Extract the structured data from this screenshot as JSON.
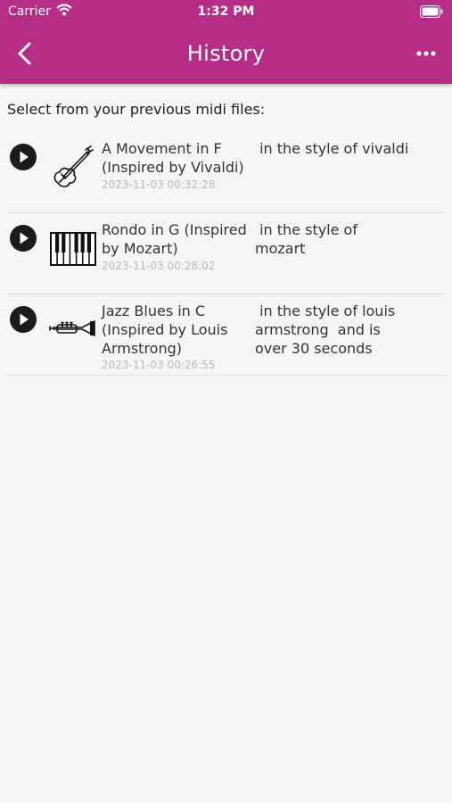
{
  "status_bar": {
    "carrier": "Carrier",
    "time": "1:32 PM"
  },
  "app_bar": {
    "title": "History"
  },
  "intro": "Select from your previous midi files:",
  "history": [
    {
      "title_line1": "A Movement in F",
      "title_line2": "(Inspired by Vivaldi)",
      "title_line3": "",
      "timestamp": "2023-11-03 00:32:28",
      "desc_line1": " in the style of vivaldi",
      "desc_line2": "",
      "desc_line3": "",
      "instrument": "violin-icon"
    },
    {
      "title_line1": "Rondo in G (Inspired",
      "title_line2": "by Mozart)",
      "title_line3": "",
      "timestamp": "2023-11-03 00:28:02",
      "desc_line1": " in the style of",
      "desc_line2": "mozart",
      "desc_line3": "",
      "instrument": "piano-keys-icon"
    },
    {
      "title_line1": "Jazz Blues in C",
      "title_line2": "(Inspired by Louis",
      "title_line3": "Armstrong)",
      "timestamp": "2023-11-03 00:26:55",
      "desc_line1": " in the style of louis",
      "desc_line2": "armstrong  and is",
      "desc_line3": "over 30 seconds",
      "instrument": "trumpet-icon"
    }
  ],
  "colors": {
    "app_bar": "#b52d87",
    "background": "#f6f6f6",
    "text": "#333333",
    "timestamp": "#b9b9b9"
  }
}
